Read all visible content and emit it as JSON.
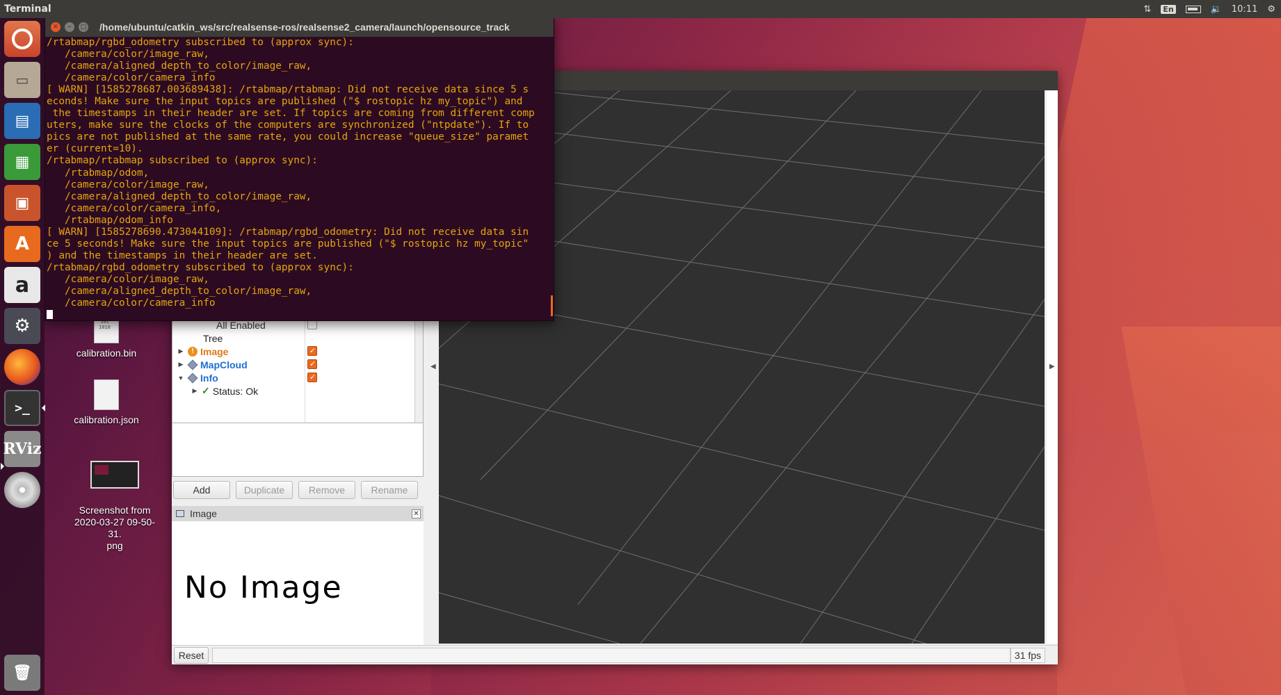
{
  "top_panel": {
    "app_name": "Terminal",
    "keyboard_layout": "En",
    "time": "10:11"
  },
  "launcher": {
    "items": [
      {
        "name": "Search your computer",
        "icon": "ubuntu-logo-icon"
      },
      {
        "name": "Files",
        "icon": "files-icon"
      },
      {
        "name": "LibreOffice Writer",
        "icon": "writer-icon"
      },
      {
        "name": "LibreOffice Calc",
        "icon": "calc-icon"
      },
      {
        "name": "LibreOffice Impress",
        "icon": "impress-icon"
      },
      {
        "name": "Ubuntu Software",
        "icon": "software-center-icon"
      },
      {
        "name": "Amazon",
        "icon": "amazon-icon",
        "glyph": "a"
      },
      {
        "name": "System Settings",
        "icon": "settings-icon"
      },
      {
        "name": "Firefox",
        "icon": "firefox-icon"
      },
      {
        "name": "Terminal",
        "icon": "terminal-icon",
        "glyph": ">_"
      },
      {
        "name": "RViz",
        "icon": "rviz-icon",
        "glyph": "RViz"
      },
      {
        "name": "DVD",
        "icon": "dvd-icon"
      },
      {
        "name": "Trash",
        "icon": "trash-icon"
      }
    ]
  },
  "desktop": {
    "icons": [
      {
        "label": "calibration.bin",
        "type": "binary-file-icon",
        "preview": "101\n1010"
      },
      {
        "label": "calibration.json",
        "type": "text-file-icon"
      },
      {
        "label": "Screenshot from\n2020-03-27 09-50-31.\npng",
        "type": "image-thumbnail-icon"
      }
    ]
  },
  "terminal": {
    "title": "/home/ubuntu/catkin_ws/src/realsense-ros/realsense2_camera/launch/opensource_track",
    "lines": [
      "/rtabmap/rgbd_odometry subscribed to (approx sync):",
      "   /camera/color/image_raw,",
      "   /camera/aligned_depth_to_color/image_raw,",
      "   /camera/color/camera_info",
      "[ WARN] [1585278687.003689438]: /rtabmap/rtabmap: Did not receive data since 5 s",
      "econds! Make sure the input topics are published (\"$ rostopic hz my_topic\") and",
      " the timestamps in their header are set. If topics are coming from different comp",
      "uters, make sure the clocks of the computers are synchronized (\"ntpdate\"). If to",
      "pics are not published at the same rate, you could increase \"queue_size\" paramet",
      "er (current=10).",
      "/rtabmap/rtabmap subscribed to (approx sync):",
      "   /rtabmap/odom,",
      "   /camera/color/image_raw,",
      "   /camera/aligned_depth_to_color/image_raw,",
      "   /camera/color/camera_info,",
      "   /rtabmap/odom_info",
      "[ WARN] [1585278690.473044109]: /rtabmap/rgbd_odometry: Did not receive data sin",
      "ce 5 seconds! Make sure the input topics are published (\"$ rostopic hz my_topic\"",
      ") and the timestamps in their header are set.",
      "/rtabmap/rgbd_odometry subscribed to (approx sync):",
      "   /camera/color/image_raw,",
      "   /camera/aligned_depth_to_color/image_raw,",
      "   /camera/color/camera_info"
    ],
    "text_color": "#e6a50e",
    "background": "#2c0b22"
  },
  "rviz": {
    "displays": {
      "partial_rows": [
        "All Enabled",
        "Tree"
      ],
      "items": [
        {
          "name": "Image",
          "status": "warning",
          "enabled": true,
          "expanded": false
        },
        {
          "name": "MapCloud",
          "status": "ok",
          "enabled": true,
          "expanded": false
        },
        {
          "name": "Info",
          "status": "ok",
          "enabled": true,
          "expanded": true
        }
      ],
      "status_row": "Status: Ok"
    },
    "buttons": {
      "add": "Add",
      "duplicate": "Duplicate",
      "remove": "Remove",
      "rename": "Rename"
    },
    "image_panel": {
      "title": "Image",
      "placeholder": "No Image"
    },
    "status_bar": {
      "reset": "Reset",
      "fps": "31 fps"
    },
    "view_background": "#303030",
    "grid_color": "#8a8a8a"
  }
}
